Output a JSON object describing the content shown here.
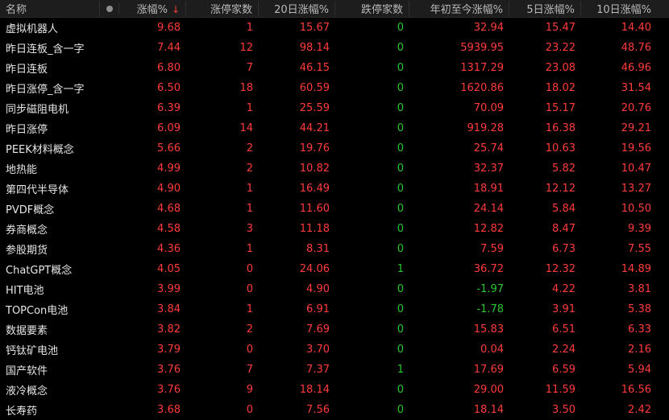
{
  "header": {
    "name": "名称",
    "pct_change": "涨幅%",
    "sort_arrow": "↓",
    "limit_up_count": "涨停家数",
    "change_20d": "20日涨幅%",
    "limit_down_count": "跌停家数",
    "ytd_change": "年初至今涨幅%",
    "change_5d": "5日涨幅%",
    "change_10d": "10日涨幅%"
  },
  "colors": {
    "up": "#ff3b3b",
    "down": "#27c82f",
    "neutral": "#e6e6e6"
  },
  "rows": [
    {
      "name": "虚拟机器人",
      "pct": "9.68",
      "limit_up": "1",
      "p20": "15.67",
      "limit_down": "0",
      "ytd": "32.94",
      "p5": "15.47",
      "p10": "14.40"
    },
    {
      "name": "昨日连板_含一字",
      "pct": "7.44",
      "limit_up": "12",
      "p20": "98.14",
      "limit_down": "0",
      "ytd": "5939.95",
      "p5": "23.22",
      "p10": "48.76"
    },
    {
      "name": "昨日连板",
      "pct": "6.80",
      "limit_up": "7",
      "p20": "46.15",
      "limit_down": "0",
      "ytd": "1317.29",
      "p5": "23.08",
      "p10": "46.96"
    },
    {
      "name": "昨日涨停_含一字",
      "pct": "6.50",
      "limit_up": "18",
      "p20": "60.59",
      "limit_down": "0",
      "ytd": "1620.86",
      "p5": "18.02",
      "p10": "31.54"
    },
    {
      "name": "同步磁阻电机",
      "pct": "6.39",
      "limit_up": "1",
      "p20": "25.59",
      "limit_down": "0",
      "ytd": "70.09",
      "p5": "15.17",
      "p10": "20.76"
    },
    {
      "name": "昨日涨停",
      "pct": "6.09",
      "limit_up": "14",
      "p20": "44.21",
      "limit_down": "0",
      "ytd": "919.28",
      "p5": "16.38",
      "p10": "29.21"
    },
    {
      "name": "PEEK材料概念",
      "pct": "5.66",
      "limit_up": "2",
      "p20": "19.76",
      "limit_down": "0",
      "ytd": "25.74",
      "p5": "10.63",
      "p10": "19.56"
    },
    {
      "name": "地热能",
      "pct": "4.99",
      "limit_up": "2",
      "p20": "10.82",
      "limit_down": "0",
      "ytd": "32.37",
      "p5": "5.82",
      "p10": "10.47"
    },
    {
      "name": "第四代半导体",
      "pct": "4.90",
      "limit_up": "1",
      "p20": "16.49",
      "limit_down": "0",
      "ytd": "18.91",
      "p5": "12.12",
      "p10": "13.27"
    },
    {
      "name": "PVDF概念",
      "pct": "4.68",
      "limit_up": "1",
      "p20": "11.60",
      "limit_down": "0",
      "ytd": "24.14",
      "p5": "5.84",
      "p10": "10.50"
    },
    {
      "name": "券商概念",
      "pct": "4.58",
      "limit_up": "3",
      "p20": "11.18",
      "limit_down": "0",
      "ytd": "12.82",
      "p5": "8.47",
      "p10": "9.39"
    },
    {
      "name": "参股期货",
      "pct": "4.36",
      "limit_up": "1",
      "p20": "8.31",
      "limit_down": "0",
      "ytd": "7.59",
      "p5": "6.73",
      "p10": "7.55"
    },
    {
      "name": "ChatGPT概念",
      "pct": "4.05",
      "limit_up": "0",
      "p20": "24.06",
      "limit_down": "1",
      "ytd": "36.72",
      "p5": "12.32",
      "p10": "14.89"
    },
    {
      "name": "HIT电池",
      "pct": "3.99",
      "limit_up": "0",
      "p20": "4.90",
      "limit_down": "0",
      "ytd": "-1.97",
      "p5": "4.22",
      "p10": "3.81"
    },
    {
      "name": "TOPCon电池",
      "pct": "3.84",
      "limit_up": "1",
      "p20": "6.91",
      "limit_down": "0",
      "ytd": "-1.78",
      "p5": "3.91",
      "p10": "5.38"
    },
    {
      "name": "数据要素",
      "pct": "3.82",
      "limit_up": "2",
      "p20": "7.69",
      "limit_down": "0",
      "ytd": "15.83",
      "p5": "6.51",
      "p10": "6.33"
    },
    {
      "name": "钙钛矿电池",
      "pct": "3.79",
      "limit_up": "0",
      "p20": "3.70",
      "limit_down": "0",
      "ytd": "0.04",
      "p5": "2.24",
      "p10": "2.16"
    },
    {
      "name": "国产软件",
      "pct": "3.76",
      "limit_up": "7",
      "p20": "7.37",
      "limit_down": "1",
      "ytd": "17.69",
      "p5": "6.59",
      "p10": "5.94"
    },
    {
      "name": "液冷概念",
      "pct": "3.76",
      "limit_up": "9",
      "p20": "18.14",
      "limit_down": "0",
      "ytd": "29.00",
      "p5": "11.59",
      "p10": "16.56"
    },
    {
      "name": "长寿药",
      "pct": "3.68",
      "limit_up": "0",
      "p20": "7.56",
      "limit_down": "0",
      "ytd": "18.14",
      "p5": "3.50",
      "p10": "2.42"
    }
  ]
}
